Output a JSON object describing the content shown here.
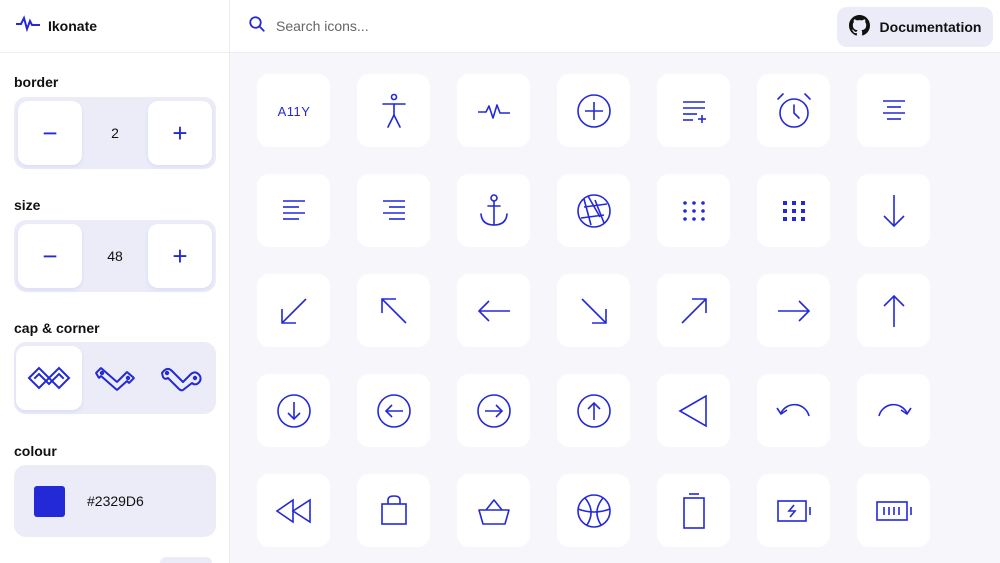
{
  "app": {
    "name": "Ikonate"
  },
  "search": {
    "placeholder": "Search icons..."
  },
  "documentation": {
    "label": "Documentation"
  },
  "controls": {
    "border": {
      "label": "border",
      "value": "2",
      "minus": "−",
      "plus": "+"
    },
    "size": {
      "label": "size",
      "value": "48",
      "minus": "−",
      "plus": "+"
    },
    "cap_corner": {
      "label": "cap & corner",
      "options": [
        "square-miter",
        "round-bevel",
        "round-round"
      ],
      "selected": 0
    },
    "colour": {
      "label": "colour",
      "value": "#2329D6"
    }
  },
  "colors": {
    "accent": "#2329D6",
    "panel": "#ebecf8",
    "background": "#f7f7fb"
  },
  "icons": {
    "a11y_text": "A11Y",
    "row1": [
      "a11y-icon",
      "accessibility-icon",
      "activity-icon",
      "add-circle-icon",
      "add-to-list-icon",
      "alarm-icon",
      "align-center-icon"
    ],
    "row2": [
      "align-left-icon",
      "align-right-icon",
      "anchor-icon",
      "aperture-icon",
      "apps-alt-icon",
      "apps-icon",
      "arrow-down-icon"
    ],
    "row3": [
      "arrow-down-left-icon",
      "arrow-up-left-icon",
      "arrow-left-icon",
      "arrow-down-right-icon",
      "arrow-up-right-icon",
      "arrow-right-icon",
      "arrow-up-icon"
    ],
    "row4": [
      "arrow-down-circle-icon",
      "arrow-left-circle-icon",
      "arrow-right-circle-icon",
      "arrow-up-circle-icon",
      "back-icon",
      "rotate-left-icon",
      "rotate-right-icon"
    ],
    "row5": [
      "rewind-icon",
      "bag-icon",
      "basket-icon",
      "basketball-icon",
      "battery-empty-icon",
      "battery-charging-icon",
      "battery-full-icon"
    ]
  }
}
